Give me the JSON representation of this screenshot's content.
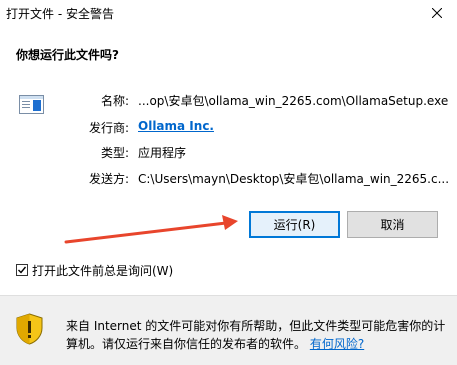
{
  "window": {
    "title": "打开文件 - 安全警告"
  },
  "prompt": {
    "question": "你想运行此文件吗?"
  },
  "file_info": {
    "rows": [
      {
        "label": "名称:",
        "value": "...op\\安卓包\\ollama_win_2265.com\\OllamaSetup.exe"
      },
      {
        "label": "发行商:",
        "value": "Ollama Inc."
      },
      {
        "label": "类型:",
        "value": "应用程序"
      },
      {
        "label": "发送方:",
        "value": "C:\\Users\\mayn\\Desktop\\安卓包\\ollama_win_2265.c..."
      }
    ]
  },
  "buttons": {
    "run_label": "运行(R)",
    "cancel_label": "取消"
  },
  "checkbox": {
    "label": "打开此文件前总是询问(W)",
    "checked": true
  },
  "warning": {
    "text": "来自 Internet 的文件可能对你有所帮助，但此文件类型可能危害你的计算机。请仅运行来自你信任的发布者的软件。",
    "link": "有何风险?"
  },
  "colors": {
    "link": "#0066cc",
    "arrow": "#e8452c",
    "run_button_border": "#0078d7",
    "bottom_panel": "#f0f0f0"
  },
  "icons": {
    "file": "application-window-icon",
    "shield": "security-shield-icon",
    "close": "close-icon",
    "check": "checkmark-icon",
    "arrow": "red-arrow-annotation"
  }
}
